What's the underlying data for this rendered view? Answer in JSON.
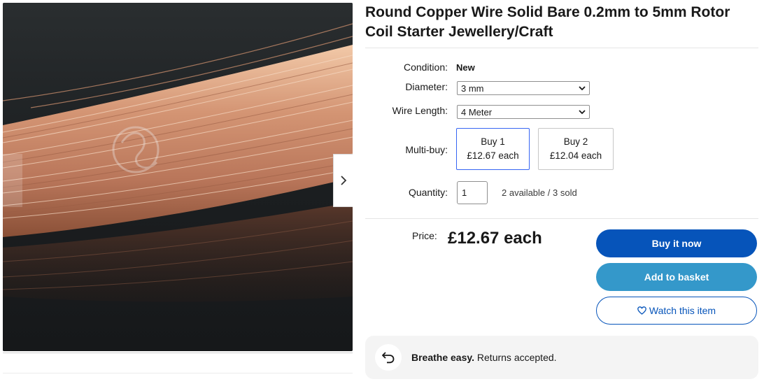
{
  "gallery": {
    "next_icon": "chevron-right-icon"
  },
  "listing": {
    "title": "Round Copper Wire Solid Bare 0.2mm to 5mm Rotor Coil Starter Jewellery/Craft"
  },
  "details": {
    "condition_label": "Condition:",
    "condition_value": "New",
    "diameter_label": "Diameter:",
    "diameter_value": "3 mm",
    "wire_length_label": "Wire Length:",
    "wire_length_value": "4 Meter",
    "multibuy_label": "Multi-buy:",
    "multibuy_options": [
      {
        "label": "Buy 1",
        "price": "£12.67 each",
        "selected": true
      },
      {
        "label": "Buy 2",
        "price": "£12.04 each",
        "selected": false
      }
    ],
    "quantity_label": "Quantity:",
    "quantity_value": "1",
    "availability": "2 available / 3 sold"
  },
  "pricing": {
    "price_label": "Price:",
    "price_value": "£12.67 each"
  },
  "actions": {
    "buy_now": "Buy it now",
    "add_to_basket": "Add to basket",
    "watch": "Watch this item"
  },
  "returns": {
    "bold": "Breathe easy.",
    "text": " Returns accepted."
  },
  "colors": {
    "buy_now_bg": "#0654ba",
    "basket_bg": "#3498ca",
    "selected_border": "#3665f3"
  }
}
